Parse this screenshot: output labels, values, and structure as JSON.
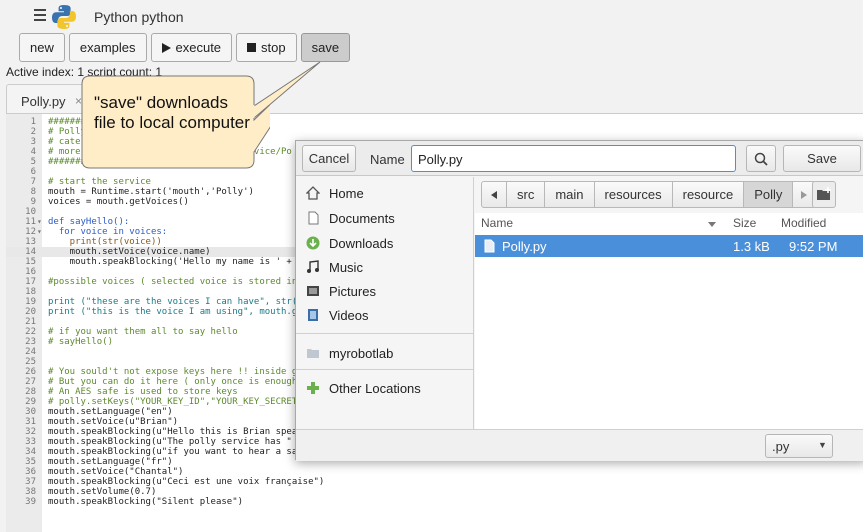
{
  "header": {
    "title": "Python  python"
  },
  "toolbar": {
    "new_label": "new",
    "examples_label": "examples",
    "execute_label": "execute",
    "stop_label": "stop",
    "save_label": "save"
  },
  "status_text": "Active index: 1 script count: 1",
  "tab": {
    "label": "Polly.py",
    "close": "×"
  },
  "callout": {
    "text": "\"save\" downloads file to local computer"
  },
  "code": [
    {
      "n": "1",
      "t": "#########################################",
      "c": "cm"
    },
    {
      "n": "2",
      "t": "# Polly",
      "c": "cm"
    },
    {
      "n": "3",
      "t": "# cate",
      "c": "cm"
    },
    {
      "n": "4",
      "t": "# more                               rvice/Po",
      "c": "cm"
    },
    {
      "n": "5",
      "t": "#######                             #",
      "c": "cm"
    },
    {
      "n": "6",
      "t": "",
      "c": ""
    },
    {
      "n": "7",
      "t": "# start the service",
      "c": "cm"
    },
    {
      "n": "8",
      "t": "mouth = Runtime.start('mouth','Polly')",
      "c": ""
    },
    {
      "n": "9",
      "t": "voices = mouth.getVoices()",
      "c": ""
    },
    {
      "n": "10",
      "t": "",
      "c": ""
    },
    {
      "n": "11",
      "t": "def sayHello():",
      "c": "kw",
      "f": "▾"
    },
    {
      "n": "12",
      "t": "  for voice in voices:",
      "c": "kw",
      "f": "▾"
    },
    {
      "n": "13",
      "t": "    print(str(voice))",
      "c": "fn"
    },
    {
      "n": "14",
      "t": "    mouth.setVoice(voice.name)",
      "c": "",
      "h": true
    },
    {
      "n": "15",
      "t": "    mouth.speakBlocking('Hello my name is ' + v",
      "c": ""
    },
    {
      "n": "16",
      "t": "",
      "c": ""
    },
    {
      "n": "17",
      "t": "#possible voices ( selected voice is stored ins",
      "c": "cm"
    },
    {
      "n": "18",
      "t": "",
      "c": ""
    },
    {
      "n": "19",
      "t": "print (\"these are the voices I can have\", str(v",
      "c": "str"
    },
    {
      "n": "20",
      "t": "print (\"this is the voice I am using\", mouth.ge",
      "c": "str"
    },
    {
      "n": "21",
      "t": "",
      "c": ""
    },
    {
      "n": "22",
      "t": "# if you want them all to say hello",
      "c": "cm"
    },
    {
      "n": "23",
      "t": "# sayHello()",
      "c": "cm"
    },
    {
      "n": "24",
      "t": "",
      "c": ""
    },
    {
      "n": "25",
      "t": "",
      "c": ""
    },
    {
      "n": "26",
      "t": "# You sould't not expose keys here !! inside gu",
      "c": "cm"
    },
    {
      "n": "27",
      "t": "# But you can do it here ( only once is enough",
      "c": "cm"
    },
    {
      "n": "28",
      "t": "# An AES safe is used to store keys",
      "c": "cm"
    },
    {
      "n": "29",
      "t": "# polly.setKeys(\"YOUR_KEY_ID\",\"YOUR_KEY_SECRET",
      "c": "cm"
    },
    {
      "n": "30",
      "t": "mouth.setLanguage(\"en\")",
      "c": ""
    },
    {
      "n": "31",
      "t": "mouth.setVoice(u\"Brian\")",
      "c": ""
    },
    {
      "n": "32",
      "t": "mouth.speakBlocking(u\"Hello this is Brian speak",
      "c": ""
    },
    {
      "n": "33",
      "t": "mouth.speakBlocking(u\"The polly service has \" + str(voices.size()) + \" voices to choose from\")",
      "c": ""
    },
    {
      "n": "34",
      "t": "mouth.speakBlocking(u\"if you want to hear a sample of them all, uncomment the say hello method in this script\")",
      "c": ""
    },
    {
      "n": "35",
      "t": "mouth.setLanguage(\"fr\")",
      "c": ""
    },
    {
      "n": "36",
      "t": "mouth.setVoice(\"Chantal\")",
      "c": ""
    },
    {
      "n": "37",
      "t": "mouth.speakBlocking(u\"Ceci est une voix française\")",
      "c": ""
    },
    {
      "n": "38",
      "t": "mouth.setVolume(0.7)",
      "c": ""
    },
    {
      "n": "39",
      "t": "mouth.speakBlocking(\"Silent please\")",
      "c": ""
    }
  ],
  "dialog": {
    "cancel_label": "Cancel",
    "name_label": "Name",
    "filename": "Polly.py",
    "save_label": "Save",
    "places": [
      "Home",
      "Documents",
      "Downloads",
      "Music",
      "Pictures",
      "Videos",
      "myrobotlab",
      "Other Locations"
    ],
    "path": [
      "src",
      "main",
      "resources",
      "resource",
      "Polly"
    ],
    "columns": {
      "name": "Name",
      "size": "Size",
      "modified": "Modified"
    },
    "file": {
      "name": "Polly.py",
      "size": "1.3 kB",
      "modified": "9:52 PM"
    },
    "filter": ".py"
  },
  "colors": {
    "accent": "#4a8fd9",
    "callout_fill": "#ffedc8"
  }
}
